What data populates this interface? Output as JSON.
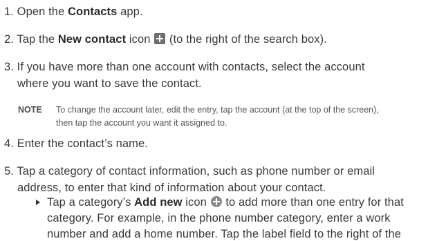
{
  "steps": [
    {
      "number": "1.",
      "pre": "Open the ",
      "bold": "Contacts",
      "post": " app."
    },
    {
      "number": "2.",
      "pre": "Tap the ",
      "bold": "New contact",
      "mid": " icon ",
      "post": " (to the right of the search box).",
      "icon": "new-contact-plus-icon"
    },
    {
      "number": "3.",
      "lines": [
        "If you have more than one account with contacts, select the account",
        "where you want to save the contact."
      ]
    },
    {
      "number": "4.",
      "text": "Enter the contact’s name."
    },
    {
      "number": "5.",
      "lines": [
        "Tap a category of contact information, such as phone number or email",
        "address, to enter that kind of information about your contact."
      ]
    }
  ],
  "note": {
    "label": "NOTE",
    "lines": [
      "To change the account later, edit the entry, tap the account (at the top of the screen),",
      "then tap the account you want it assigned to."
    ]
  },
  "subbullet": {
    "pre": "Tap a category’s ",
    "bold": "Add new",
    "mid": " icon ",
    "post": " to add more than one entry for that",
    "icon": "add-new-plus-icon",
    "lines": [
      "category. For example, in the phone number category, enter a work",
      "number and add a home number. Tap the label field to the right of the"
    ]
  }
}
